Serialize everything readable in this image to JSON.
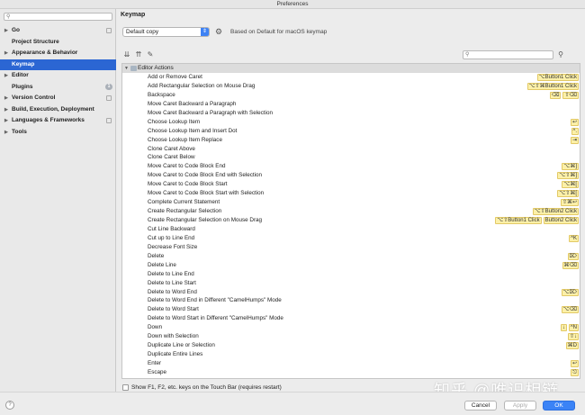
{
  "window": {
    "title": "Preferences"
  },
  "sidebar": {
    "search_placeholder": "",
    "items": [
      {
        "label": "Go",
        "has_arrow": true,
        "page_icon": true
      },
      {
        "label": "Project Structure",
        "has_arrow": false,
        "page_icon": false
      },
      {
        "label": "Appearance & Behavior",
        "has_arrow": true,
        "page_icon": false
      },
      {
        "label": "Keymap",
        "has_arrow": false,
        "page_icon": false,
        "selected": true
      },
      {
        "label": "Editor",
        "has_arrow": true,
        "page_icon": false
      },
      {
        "label": "Plugins",
        "has_arrow": false,
        "badge": "1"
      },
      {
        "label": "Version Control",
        "has_arrow": true,
        "page_icon": true
      },
      {
        "label": "Build, Execution, Deployment",
        "has_arrow": true,
        "page_icon": false
      },
      {
        "label": "Languages & Frameworks",
        "has_arrow": true,
        "page_icon": true
      },
      {
        "label": "Tools",
        "has_arrow": true,
        "page_icon": false
      }
    ]
  },
  "main": {
    "heading": "Keymap",
    "keymap_select": "Default copy",
    "based_on": "Based on Default for macOS keymap",
    "tree": {
      "group": "Editor Actions",
      "actions": [
        {
          "name": "Add or Remove Caret",
          "shortcuts": [
            "⌥Button1 Click"
          ]
        },
        {
          "name": "Add Rectangular Selection on Mouse Drag",
          "shortcuts": [
            "⌥⇧⌘Button1 Click"
          ]
        },
        {
          "name": "Backspace",
          "shortcuts": [
            "⌫",
            "⇧⌫"
          ]
        },
        {
          "name": "Move Caret Backward a Paragraph",
          "shortcuts": []
        },
        {
          "name": "Move Caret Backward a Paragraph with Selection",
          "shortcuts": []
        },
        {
          "name": "Choose Lookup Item",
          "shortcuts": [
            "↩"
          ]
        },
        {
          "name": "Choose Lookup Item and Insert Dot",
          "shortcuts": [
            "^."
          ]
        },
        {
          "name": "Choose Lookup Item Replace",
          "shortcuts": [
            "⇥"
          ]
        },
        {
          "name": "Clone Caret Above",
          "shortcuts": []
        },
        {
          "name": "Clone Caret Below",
          "shortcuts": []
        },
        {
          "name": "Move Caret to Code Block End",
          "shortcuts": [
            "⌥⌘]"
          ]
        },
        {
          "name": "Move Caret to Code Block End with Selection",
          "shortcuts": [
            "⌥⇧⌘]"
          ]
        },
        {
          "name": "Move Caret to Code Block Start",
          "shortcuts": [
            "⌥⌘["
          ]
        },
        {
          "name": "Move Caret to Code Block Start with Selection",
          "shortcuts": [
            "⌥⇧⌘["
          ]
        },
        {
          "name": "Complete Current Statement",
          "shortcuts": [
            "⇧⌘↩"
          ]
        },
        {
          "name": "Create Rectangular Selection",
          "shortcuts": [
            "⌥⇧Button2 Click"
          ]
        },
        {
          "name": "Create Rectangular Selection on Mouse Drag",
          "shortcuts": [
            "⌥⇧Button1 Click",
            "Button2 Click"
          ]
        },
        {
          "name": "Cut Line Backward",
          "shortcuts": []
        },
        {
          "name": "Cut up to Line End",
          "shortcuts": [
            "^K"
          ]
        },
        {
          "name": "Decrease Font Size",
          "shortcuts": []
        },
        {
          "name": "Delete",
          "shortcuts": [
            "⌦"
          ]
        },
        {
          "name": "Delete Line",
          "shortcuts": [
            "⌘⌫"
          ]
        },
        {
          "name": "Delete to Line End",
          "shortcuts": []
        },
        {
          "name": "Delete to Line Start",
          "shortcuts": []
        },
        {
          "name": "Delete to Word End",
          "shortcuts": [
            "⌥⌦"
          ]
        },
        {
          "name": "Delete to Word End in Different \"CamelHumps\" Mode",
          "shortcuts": []
        },
        {
          "name": "Delete to Word Start",
          "shortcuts": [
            "⌥⌫"
          ]
        },
        {
          "name": "Delete to Word Start in Different \"CamelHumps\" Mode",
          "shortcuts": []
        },
        {
          "name": "Down",
          "shortcuts": [
            "↓",
            "^N"
          ]
        },
        {
          "name": "Down with Selection",
          "shortcuts": [
            "⇧↓"
          ]
        },
        {
          "name": "Duplicate Line or Selection",
          "shortcuts": [
            "⌘D"
          ]
        },
        {
          "name": "Duplicate Entire Lines",
          "shortcuts": []
        },
        {
          "name": "Enter",
          "shortcuts": [
            "↩"
          ]
        },
        {
          "name": "Escape",
          "shortcuts": [
            "⎋"
          ]
        },
        {
          "name": "",
          "shortcuts": []
        }
      ]
    },
    "touchbar_label": "Show F1, F2, etc. keys on the Touch Bar (requires restart)"
  },
  "footer": {
    "help": "?",
    "cancel": "Cancel",
    "apply": "Apply",
    "ok": "OK"
  },
  "watermark": "知乎 @唯识相链",
  "colors": {
    "selection": "#2b66d3",
    "shortcut_bg": "#fcf0a8",
    "primary_button": "#3b83f6"
  }
}
